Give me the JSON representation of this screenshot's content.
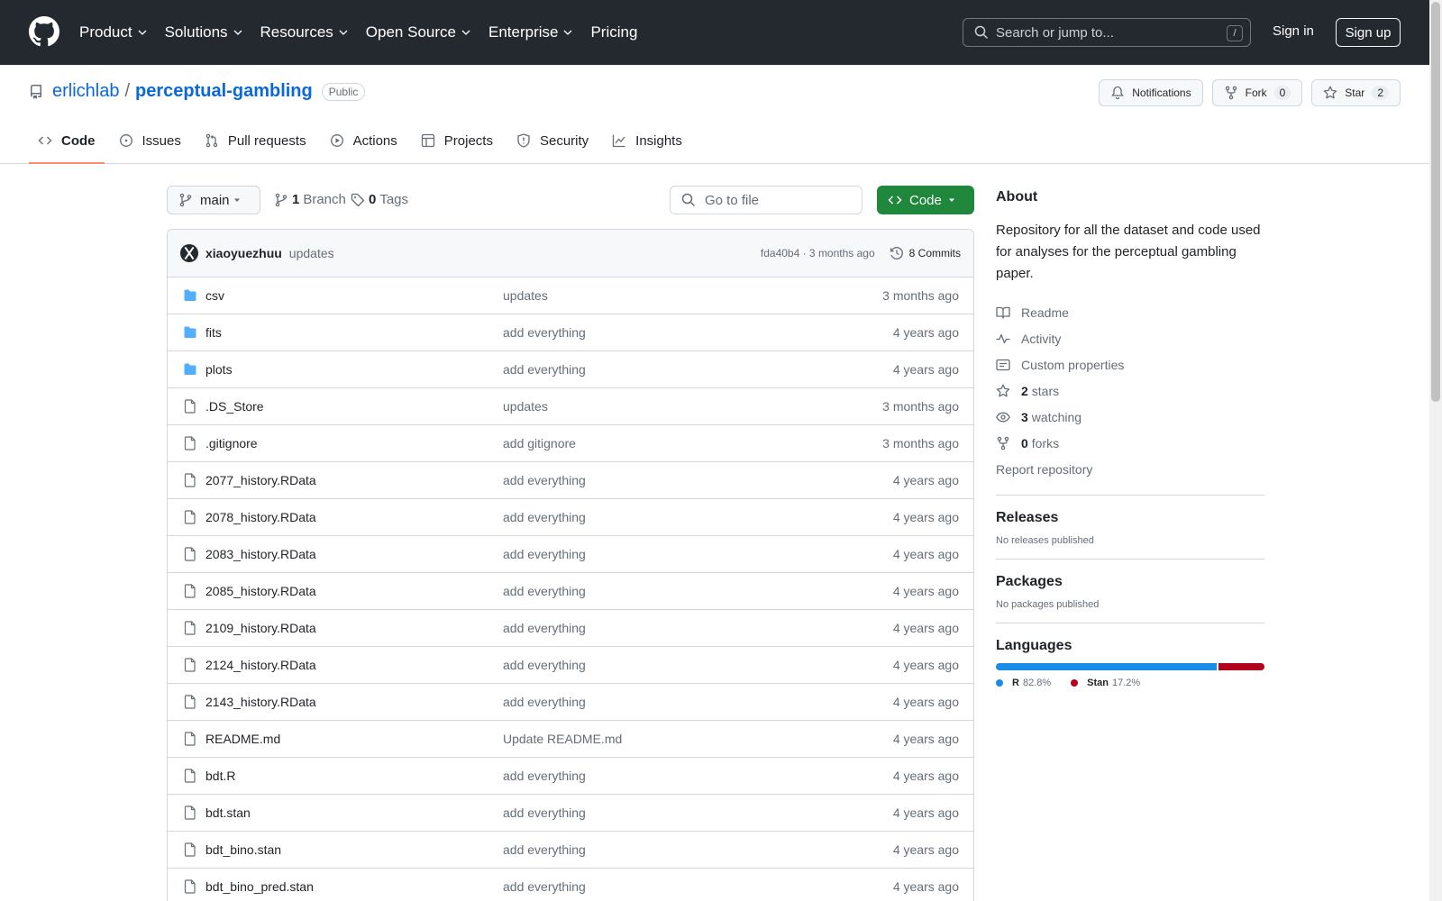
{
  "header": {
    "nav": [
      "Product",
      "Solutions",
      "Resources",
      "Open Source",
      "Enterprise",
      "Pricing"
    ],
    "search_placeholder": "Search or jump to...",
    "search_shortcut": "/",
    "signin": "Sign in",
    "signup": "Sign up"
  },
  "repo": {
    "owner": "erlichlab",
    "separator": "/",
    "name": "perceptual-gambling",
    "visibility": "Public",
    "notifications_label": "Notifications",
    "fork_label": "Fork",
    "fork_count": "0",
    "star_label": "Star",
    "star_count": "2"
  },
  "tabs": [
    {
      "label": "Code",
      "icon": "code-icon",
      "active": true
    },
    {
      "label": "Issues",
      "icon": "issue-icon"
    },
    {
      "label": "Pull requests",
      "icon": "pull-request-icon"
    },
    {
      "label": "Actions",
      "icon": "play-icon"
    },
    {
      "label": "Projects",
      "icon": "table-icon"
    },
    {
      "label": "Security",
      "icon": "shield-icon"
    },
    {
      "label": "Insights",
      "icon": "graph-icon"
    }
  ],
  "toolbar": {
    "branch": "main",
    "branch_count": "1",
    "branch_label": "Branch",
    "tag_count": "0",
    "tag_label": "Tags",
    "goto_placeholder": "Go to file",
    "code_label": "Code"
  },
  "commit": {
    "author": "xiaoyuezhuu",
    "message": "updates",
    "hash_time": "fda40b4 · 3 months ago",
    "commits": "8 Commits"
  },
  "files": [
    {
      "name": "csv",
      "type": "dir",
      "message": "updates",
      "age": "3 months ago"
    },
    {
      "name": "fits",
      "type": "dir",
      "message": "add everything",
      "age": "4 years ago"
    },
    {
      "name": "plots",
      "type": "dir",
      "message": "add everything",
      "age": "4 years ago"
    },
    {
      "name": ".DS_Store",
      "type": "file",
      "message": "updates",
      "age": "3 months ago"
    },
    {
      "name": ".gitignore",
      "type": "file",
      "message": "add gitignore",
      "age": "3 months ago"
    },
    {
      "name": "2077_history.RData",
      "type": "file",
      "message": "add everything",
      "age": "4 years ago"
    },
    {
      "name": "2078_history.RData",
      "type": "file",
      "message": "add everything",
      "age": "4 years ago"
    },
    {
      "name": "2083_history.RData",
      "type": "file",
      "message": "add everything",
      "age": "4 years ago"
    },
    {
      "name": "2085_history.RData",
      "type": "file",
      "message": "add everything",
      "age": "4 years ago"
    },
    {
      "name": "2109_history.RData",
      "type": "file",
      "message": "add everything",
      "age": "4 years ago"
    },
    {
      "name": "2124_history.RData",
      "type": "file",
      "message": "add everything",
      "age": "4 years ago"
    },
    {
      "name": "2143_history.RData",
      "type": "file",
      "message": "add everything",
      "age": "4 years ago"
    },
    {
      "name": "README.md",
      "type": "file",
      "message": "Update README.md",
      "age": "4 years ago"
    },
    {
      "name": "bdt.R",
      "type": "file",
      "message": "add everything",
      "age": "4 years ago"
    },
    {
      "name": "bdt.stan",
      "type": "file",
      "message": "add everything",
      "age": "4 years ago"
    },
    {
      "name": "bdt_bino.stan",
      "type": "file",
      "message": "add everything",
      "age": "4 years ago"
    },
    {
      "name": "bdt_bino_pred.stan",
      "type": "file",
      "message": "add everything",
      "age": "4 years ago"
    }
  ],
  "about": {
    "title": "About",
    "description": "Repository for all the dataset and code used for analyses for the perceptual gambling paper.",
    "readme": "Readme",
    "activity": "Activity",
    "custom_properties": "Custom properties",
    "stars_count": "2",
    "stars_label": "stars",
    "watching_count": "3",
    "watching_label": "watching",
    "forks_count": "0",
    "forks_label": "forks",
    "report": "Report repository"
  },
  "releases": {
    "title": "Releases",
    "text": "No releases published"
  },
  "packages": {
    "title": "Packages",
    "text": "No packages published"
  },
  "languages": {
    "title": "Languages",
    "items": [
      {
        "name": "R",
        "percent": "82.8%",
        "value": 82.8,
        "color": "#198ce7"
      },
      {
        "name": "Stan",
        "percent": "17.2%",
        "value": 17.2,
        "color": "#b2011d"
      }
    ]
  }
}
